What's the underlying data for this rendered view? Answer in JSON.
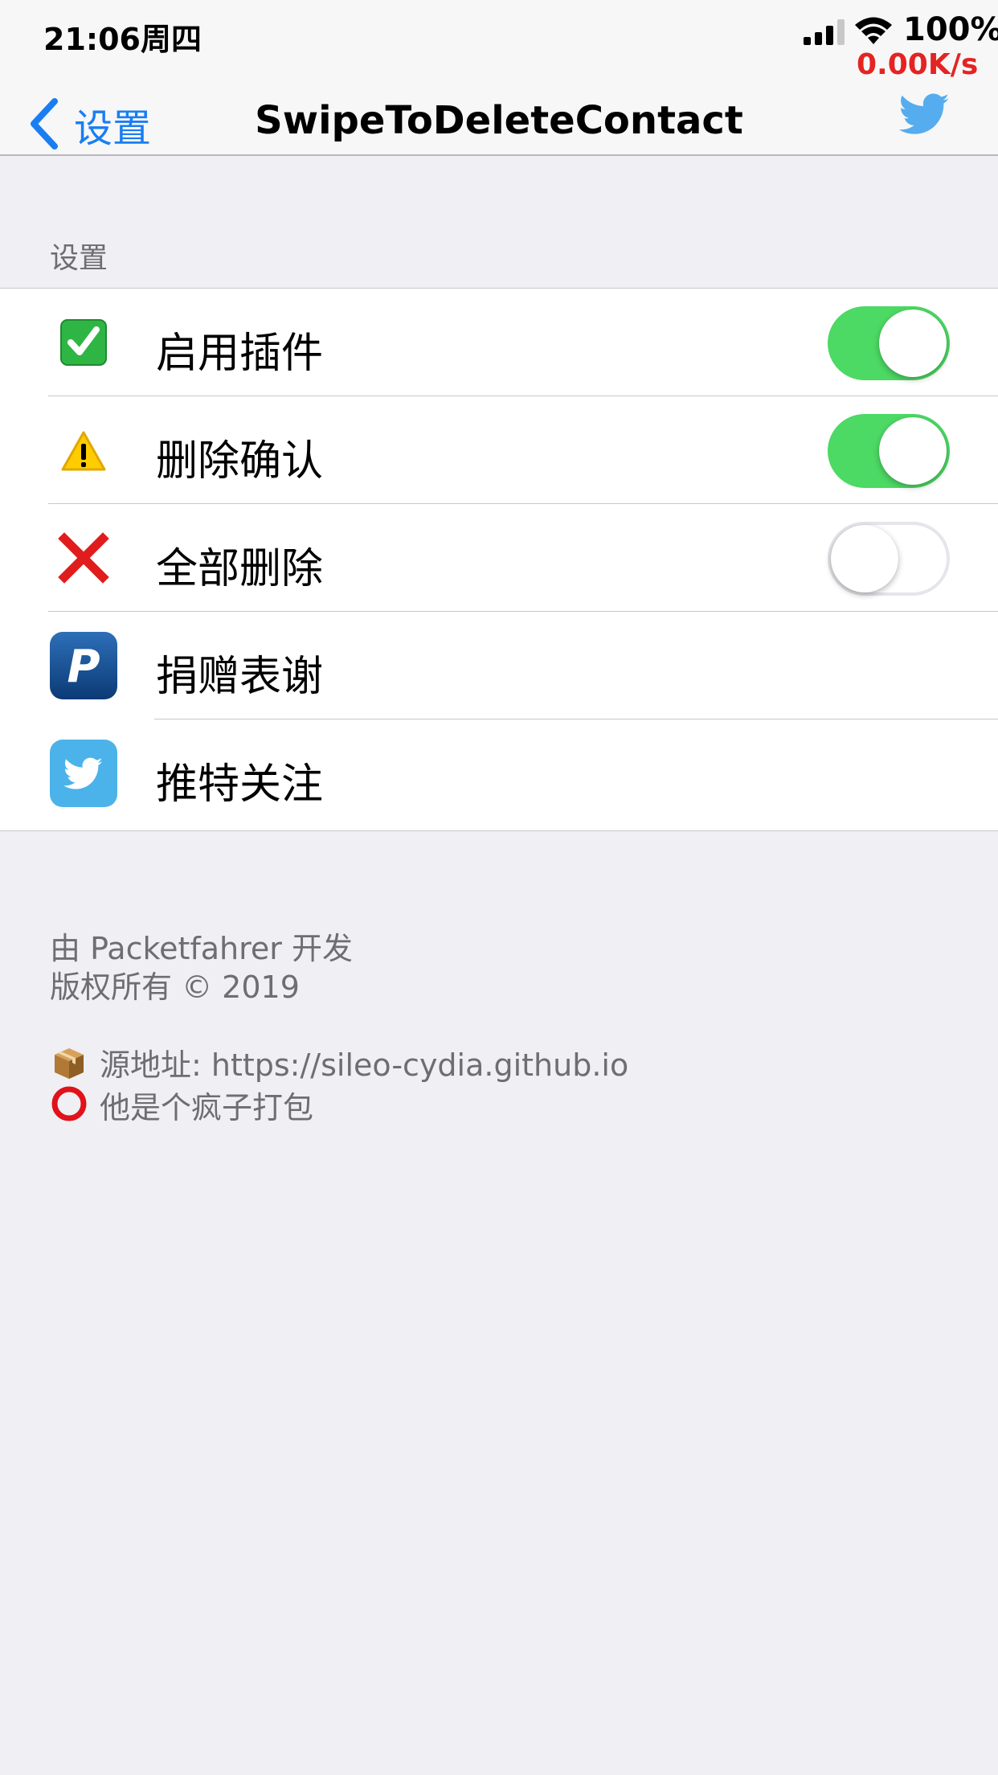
{
  "status_bar": {
    "time": "21:06周四",
    "battery": "100%",
    "net_speed": "0.00K/s"
  },
  "nav": {
    "back_label": "设置",
    "title": "SwipeToDeleteContact"
  },
  "section": {
    "header": "设置",
    "rows": [
      {
        "label": "启用插件",
        "icon": "check-mark-icon",
        "toggle": true
      },
      {
        "label": "删除确认",
        "icon": "warning-icon",
        "toggle": true
      },
      {
        "label": "全部删除",
        "icon": "cross-mark-icon",
        "toggle": false
      },
      {
        "label": "捐赠表谢",
        "icon": "paypal-icon"
      },
      {
        "label": "推特关注",
        "icon": "twitter-icon"
      }
    ]
  },
  "footer": {
    "line1": "由 Packetfahrer 开发",
    "line2": "版权所有 © 2019",
    "line3": "源地址: https://sileo-cydia.github.io",
    "line4": "他是个疯子打包"
  },
  "colors": {
    "accent": "#1a7ef2",
    "toggle_on": "#4cd964",
    "net_speed": "#e52323",
    "background": "#efeff4"
  }
}
